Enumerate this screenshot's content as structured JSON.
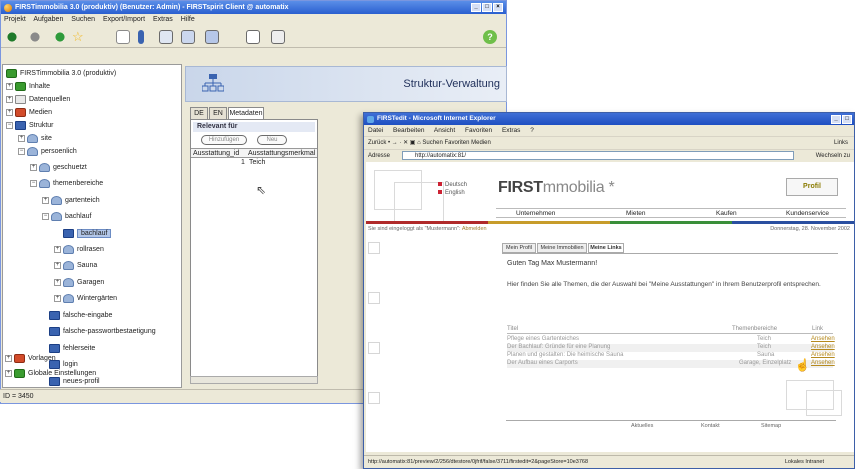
{
  "w1": {
    "title": "FIRSTimmobilia 3.0 (produktiv) (Benutzer: Admin) - FIRSTspirit Client @ automatix",
    "menu": [
      "Projekt",
      "Aufgaben",
      "Suchen",
      "Export/Import",
      "Extras",
      "Hilfe"
    ],
    "tree": {
      "root": "FIRSTimmobilia 3.0 (produktiv)",
      "inhalte": "Inhalte",
      "datenquellen": "Datenquellen",
      "medien": "Medien",
      "struktur": "Struktur",
      "site": "site",
      "persoenlich": "persoenlich",
      "geschuetzt": "geschuetzt",
      "themenbereiche": "themenbereiche",
      "gartenteich": "gartenteich",
      "bachlauf_folder": "bachlauf",
      "bachlauf_page": "bachlauf",
      "rollrasen": "rollrasen",
      "sauna": "Sauna",
      "garagen": "Garagen",
      "wintergaerten": "Wintergärten",
      "falsche_eingabe": "falsche-eingabe",
      "falsche_passwortbestaetigung": "falsche-passwortbestaetigung",
      "fehlerseite": "fehlerseite",
      "login": "login",
      "neues_profil": "neues-profil",
      "vorlagen": "Vorlagen",
      "globale": "Globale Einstellungen"
    },
    "banner_title": "Struktur-Verwaltung",
    "tabs": [
      "DE",
      "EN",
      "Metadaten"
    ],
    "relevant_label": "Relevant für",
    "btn_add": "Hinzufügen",
    "btn_del": "Neu",
    "table_headers": [
      "Ausstattung_id",
      "Ausstattungsmerkmal"
    ],
    "table_row": {
      "id": "1",
      "name": "Teich"
    },
    "status": "ID = 3450"
  },
  "w2": {
    "title": "FIRSTedit - Microsoft Internet Explorer",
    "menu": [
      "Datei",
      "Bearbeiten",
      "Ansicht",
      "Favoriten",
      "Extras",
      "?"
    ],
    "toolbar": "Zurück  •  →  ·  ✕  ▣  ⌂   Suchen   Favoriten   Medien",
    "toolbar_links": "Links",
    "address_label": "Adresse",
    "address": "http://automatix:81/",
    "address_go": "Wechseln zu",
    "status": "http://automatix:81/preview/2/256/dtestore/0jfrif/false/3711/firstedit=2&pageStore=10e3768",
    "status_zone": "Lokales Intranet"
  },
  "site": {
    "logo_bold": "FIRST",
    "logo_rest": "mmobilia *",
    "lang_de": "Deutsch",
    "lang_en": "English",
    "profil_badge": "Profil",
    "nav": [
      "Unternehmen",
      "Mieten",
      "Kaufen",
      "Kundenservice"
    ],
    "login_prefix": "Sie sind eingeloggt als \"Mustermann\":",
    "login_link": "Abmelden",
    "date": "Donnerstag, 28. November 2002",
    "subtabs": [
      "Mein Profil",
      "Meine Immobilien",
      "Meine Links"
    ],
    "greeting": "Guten Tag Max Mustermann!",
    "intro": "Hier finden Sie alle Themen, die der Auswahl bei \"Meine Ausstattungen\" in Ihrem Benutzerprofil entsprechen.",
    "result_headers": [
      "Titel",
      "Themenbereiche",
      "Link"
    ],
    "results": [
      {
        "title": "Pflege eines Gartenteiches",
        "area": "Teich",
        "link": "Ansehen"
      },
      {
        "title": "Der Bachlauf: Gründe für eine Planung",
        "area": "Teich",
        "link": "Ansehen"
      },
      {
        "title": "Planen und gestalten: Die heimische Sauna",
        "area": "Sauna",
        "link": "Ansehen"
      },
      {
        "title": "Der Aufbau eines Carports",
        "area": "Garage, Einzelplatz",
        "link": "Ansehen"
      }
    ],
    "footer": [
      "Aktuelles",
      "Kontakt",
      "Sitemap"
    ]
  }
}
